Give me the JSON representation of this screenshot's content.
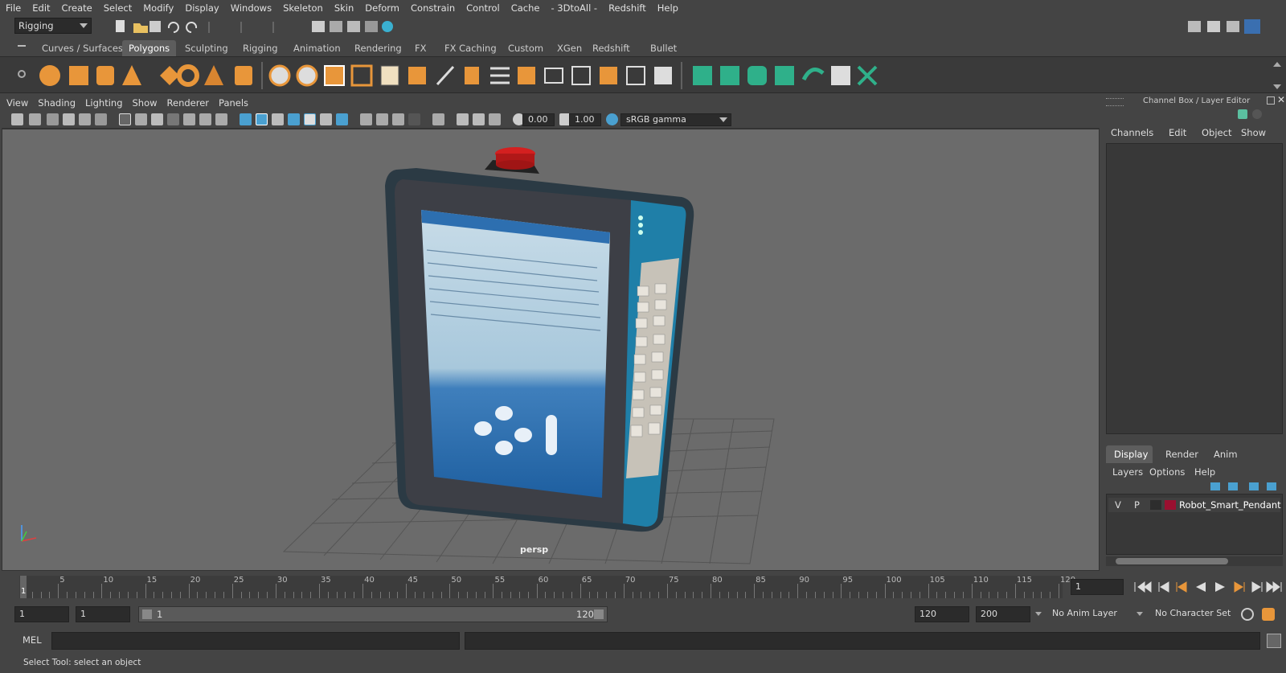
{
  "menu": [
    "File",
    "Edit",
    "Create",
    "Select",
    "Modify",
    "Display",
    "Windows",
    "Skeleton",
    "Skin",
    "Deform",
    "Constrain",
    "Control",
    "Cache",
    "- 3DtoAll -",
    "Redshift",
    "Help"
  ],
  "status": {
    "mode": "Rigging"
  },
  "shelf_tabs": [
    "Curves / Surfaces",
    "Polygons",
    "Sculpting",
    "Rigging",
    "Animation",
    "Rendering",
    "FX",
    "FX Caching",
    "Custom",
    "XGen",
    "Redshift",
    "Bullet"
  ],
  "active_shelf": "Polygons",
  "viewport_menu": [
    "View",
    "Shading",
    "Lighting",
    "Show",
    "Renderer",
    "Panels"
  ],
  "viewport_toolbar": {
    "exposure": "0.00",
    "gamma": "1.00",
    "color_space": "sRGB gamma"
  },
  "camera_label": "persp",
  "channel_box": {
    "title": "Channel Box / Layer Editor",
    "menu": [
      "Channels",
      "Edit",
      "Object",
      "Show"
    ]
  },
  "layer_editor": {
    "tabs": [
      "Display",
      "Render",
      "Anim"
    ],
    "active_tab": "Display",
    "menu": [
      "Layers",
      "Options",
      "Help"
    ],
    "layer": {
      "v": "V",
      "p": "P",
      "name": "Robot_Smart_Pendant",
      "color": "#9a1030"
    }
  },
  "timeline": {
    "ticks": [
      "5",
      "10",
      "15",
      "20",
      "25",
      "30",
      "35",
      "40",
      "45",
      "50",
      "55",
      "60",
      "65",
      "70",
      "75",
      "80",
      "85",
      "90",
      "95",
      "100",
      "105",
      "110",
      "115",
      "120"
    ],
    "current_marker": "1",
    "current_frame": "1"
  },
  "range": {
    "start": "1",
    "anim_start": "1",
    "slider_start": "1",
    "slider_end": "120",
    "anim_end": "120",
    "end": "200",
    "anim_layer": "No Anim Layer",
    "character_set": "No Character Set"
  },
  "command": {
    "label": "MEL"
  },
  "help_line": "Select Tool: select an object",
  "colors": {
    "accent": "#5d5d5d",
    "viewport": "#6b6b6b",
    "pendant_blue": "#1f7fa8",
    "estop_red": "#d42020"
  }
}
